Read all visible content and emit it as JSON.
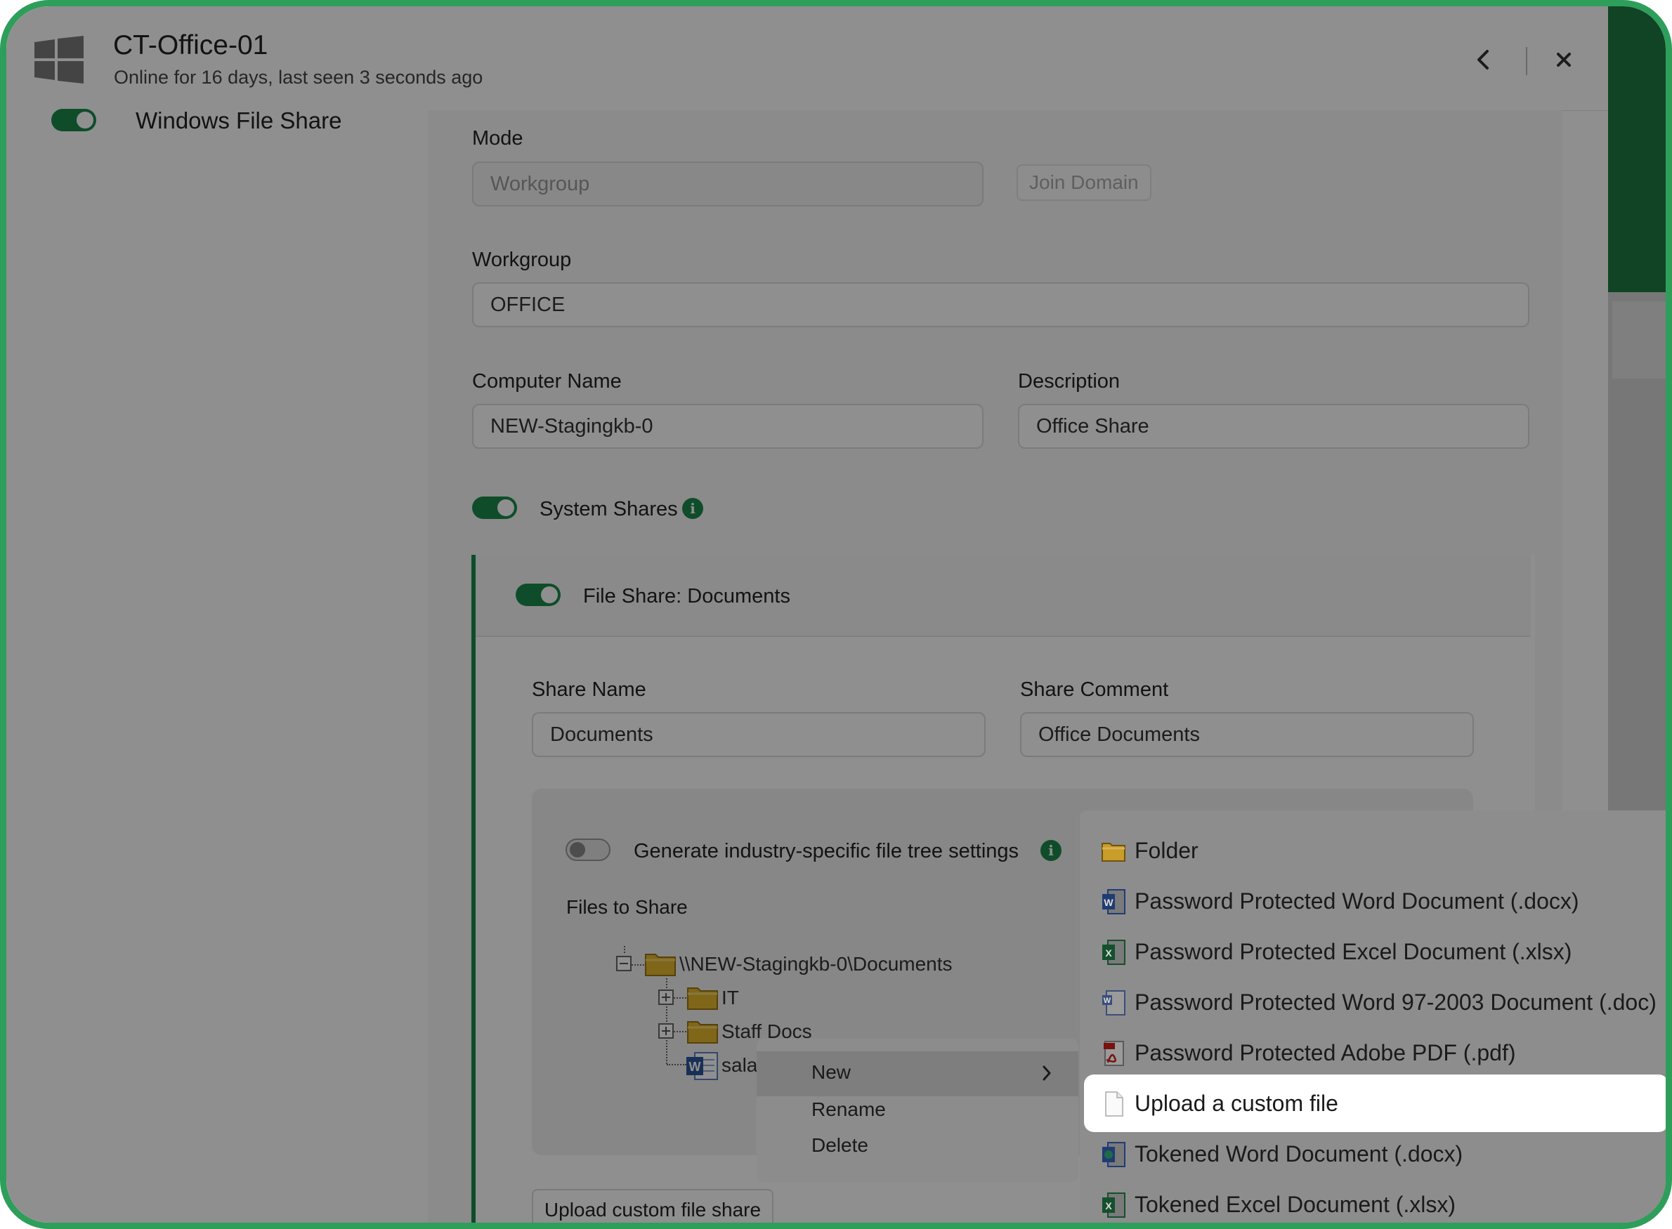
{
  "header": {
    "title": "CT-Office-01",
    "subtitle": "Online for 16 days, last seen 3 seconds ago"
  },
  "sidebar": {
    "windows_file_share": "Windows File Share"
  },
  "form": {
    "mode_label": "Mode",
    "mode_value": "Workgroup",
    "join_domain": "Join Domain",
    "workgroup_label": "Workgroup",
    "workgroup_value": "OFFICE",
    "computer_name_label": "Computer Name",
    "computer_name_value": "NEW-Stagingkb-0",
    "description_label": "Description",
    "description_value": "Office Share",
    "system_shares": "System Shares"
  },
  "share": {
    "title": "File Share: Documents",
    "share_name_label": "Share Name",
    "share_name_value": "Documents",
    "share_comment_label": "Share Comment",
    "share_comment_value": "Office Documents",
    "generate_label": "Generate industry-specific file tree settings",
    "files_label": "Files to Share",
    "upload_button": "Upload custom file share"
  },
  "tree": {
    "root": "\\\\NEW-Stagingkb-0\\Documents",
    "children": [
      "IT",
      "Staff Docs",
      "sala"
    ]
  },
  "context_menu": {
    "items": [
      "New",
      "Rename",
      "Delete"
    ]
  },
  "submenu": {
    "items": [
      "Folder",
      "Password Protected Word Document (.docx)",
      "Password Protected Excel Document (.xlsx)",
      "Password Protected Word 97-2003 Document (.doc)",
      "Password Protected Adobe PDF (.pdf)",
      "Upload a custom file",
      "Tokened Word Document (.docx)",
      "Tokened Excel Document (.xlsx)"
    ]
  },
  "toggles": {
    "windows_file_share": true,
    "system_shares": true,
    "file_share_documents": true,
    "generate_file_tree": false
  },
  "colors": {
    "accent": "#1b8a4c",
    "frame": "#2e9e5b"
  }
}
